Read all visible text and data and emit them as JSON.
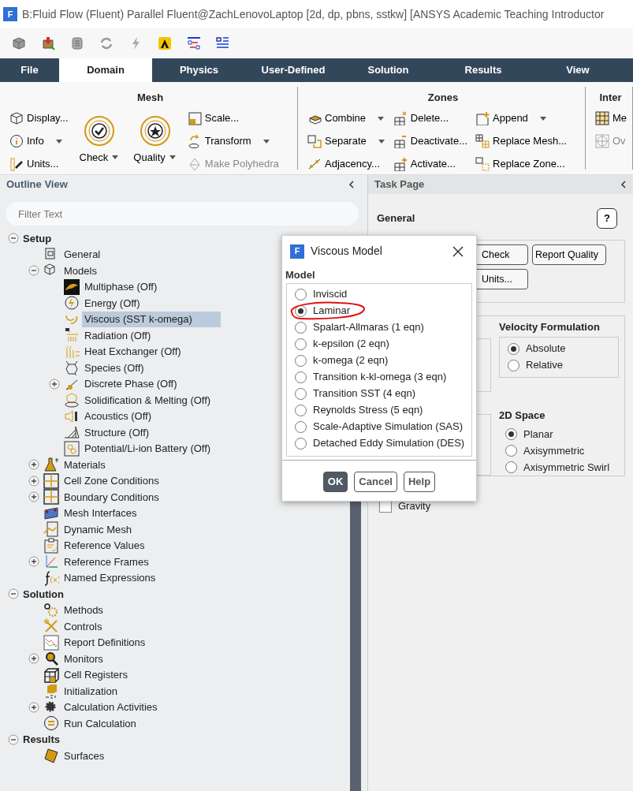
{
  "window": {
    "app_icon_letter": "F",
    "title": "B:Fluid Flow (Fluent) Parallel Fluent@ZachLenovoLaptop  [2d, dp, pbns, sstkw] [ANSYS Academic Teaching Introductor"
  },
  "ribbon_tabs": [
    {
      "label": "File",
      "selected": false
    },
    {
      "label": "Domain",
      "selected": true
    },
    {
      "label": "Physics",
      "selected": false
    },
    {
      "label": "User-Defined",
      "selected": false
    },
    {
      "label": "Solution",
      "selected": false
    },
    {
      "label": "Results",
      "selected": false
    },
    {
      "label": "View",
      "selected": false
    }
  ],
  "ribbon_groups": [
    {
      "title": "Mesh",
      "columns": [
        [
          {
            "kind": "small",
            "label": "Display...",
            "dropdown": false,
            "disabled": false
          },
          {
            "kind": "small",
            "label": "Info",
            "dropdown": true,
            "disabled": false
          },
          {
            "kind": "small",
            "label": "Units...",
            "dropdown": false,
            "disabled": false
          }
        ],
        [
          {
            "kind": "large",
            "label": "Check",
            "dropdown": true,
            "disabled": false
          }
        ],
        [
          {
            "kind": "large",
            "label": "Quality",
            "dropdown": true,
            "disabled": false
          }
        ],
        [
          {
            "kind": "small",
            "label": "Scale...",
            "dropdown": false,
            "disabled": false
          },
          {
            "kind": "small",
            "label": "Transform",
            "dropdown": true,
            "disabled": false
          },
          {
            "kind": "small",
            "label": "Make Polyhedra",
            "dropdown": false,
            "disabled": true
          }
        ]
      ]
    },
    {
      "title": "Zones",
      "columns": [
        [
          {
            "kind": "small",
            "label": "Combine",
            "dropdown": true,
            "disabled": false
          },
          {
            "kind": "small",
            "label": "Separate",
            "dropdown": true,
            "disabled": false
          },
          {
            "kind": "small",
            "label": "Adjacency...",
            "dropdown": false,
            "disabled": false
          }
        ],
        [
          {
            "kind": "small",
            "label": "Delete...",
            "dropdown": false,
            "disabled": false
          },
          {
            "kind": "small",
            "label": "Deactivate...",
            "dropdown": false,
            "disabled": false
          },
          {
            "kind": "small",
            "label": "Activate...",
            "dropdown": false,
            "disabled": false
          }
        ],
        [
          {
            "kind": "small",
            "label": "Append",
            "dropdown": true,
            "disabled": false
          },
          {
            "kind": "small",
            "label": "Replace Mesh...",
            "dropdown": false,
            "disabled": false
          },
          {
            "kind": "small",
            "label": "Replace Zone...",
            "dropdown": false,
            "disabled": false
          }
        ]
      ]
    },
    {
      "title": "Inter",
      "columns": [
        [
          {
            "kind": "small",
            "label": "Me",
            "dropdown": false,
            "disabled": false
          },
          {
            "kind": "small",
            "label": "Ov",
            "dropdown": false,
            "disabled": true
          }
        ]
      ]
    }
  ],
  "outline_view": {
    "title": "Outline View",
    "filter": {
      "placeholder": "Filter Text"
    },
    "tree": [
      {
        "kind": "section",
        "label": "Setup",
        "expanded": true,
        "selected": false,
        "children": [
          {
            "kind": "node",
            "label": "General",
            "selected": false
          },
          {
            "kind": "node",
            "label": "Models",
            "expanded": true,
            "selected": false,
            "children": [
              {
                "kind": "node",
                "label": "Multiphase (Off)",
                "selected": false
              },
              {
                "kind": "node",
                "label": "Energy (Off)",
                "selected": false
              },
              {
                "kind": "node",
                "label": "Viscous (SST k-omega)",
                "selected": true
              },
              {
                "kind": "node",
                "label": "Radiation (Off)",
                "selected": false
              },
              {
                "kind": "node",
                "label": "Heat Exchanger (Off)",
                "selected": false
              },
              {
                "kind": "node",
                "label": "Species (Off)",
                "selected": false
              },
              {
                "kind": "node",
                "label": "Discrete Phase (Off)",
                "expanded": false,
                "selected": false
              },
              {
                "kind": "node",
                "label": "Solidification & Melting (Off)",
                "selected": false
              },
              {
                "kind": "node",
                "label": "Acoustics (Off)",
                "selected": false
              },
              {
                "kind": "node",
                "label": "Structure (Off)",
                "selected": false
              },
              {
                "kind": "node",
                "label": "Potential/Li-ion Battery (Off)",
                "selected": false
              }
            ]
          },
          {
            "kind": "node",
            "label": "Materials",
            "expanded": false,
            "selected": false
          },
          {
            "kind": "node",
            "label": "Cell Zone Conditions",
            "expanded": false,
            "selected": false
          },
          {
            "kind": "node",
            "label": "Boundary Conditions",
            "expanded": false,
            "selected": false
          },
          {
            "kind": "node",
            "label": "Mesh Interfaces",
            "selected": false
          },
          {
            "kind": "node",
            "label": "Dynamic Mesh",
            "selected": false
          },
          {
            "kind": "node",
            "label": "Reference Values",
            "selected": false
          },
          {
            "kind": "node",
            "label": "Reference Frames",
            "expanded": false,
            "selected": false
          },
          {
            "kind": "node",
            "label": "Named Expressions",
            "selected": false
          }
        ]
      },
      {
        "kind": "section",
        "label": "Solution",
        "expanded": true,
        "selected": false,
        "children": [
          {
            "kind": "node",
            "label": "Methods",
            "selected": false
          },
          {
            "kind": "node",
            "label": "Controls",
            "selected": false
          },
          {
            "kind": "node",
            "label": "Report Definitions",
            "selected": false
          },
          {
            "kind": "node",
            "label": "Monitors",
            "expanded": false,
            "selected": false
          },
          {
            "kind": "node",
            "label": "Cell Registers",
            "selected": false
          },
          {
            "kind": "node",
            "label": "Initialization",
            "selected": false
          },
          {
            "kind": "node",
            "label": "Calculation Activities",
            "expanded": false,
            "selected": false
          },
          {
            "kind": "node",
            "label": "Run Calculation",
            "selected": false
          }
        ]
      },
      {
        "kind": "section",
        "label": "Results",
        "expanded": true,
        "selected": false,
        "children": [
          {
            "kind": "node",
            "label": "Surfaces",
            "selected": false
          }
        ]
      }
    ]
  },
  "task_page": {
    "header": "Task Page",
    "title": "General",
    "help_button": "?",
    "buttons": [
      {
        "label": "Check"
      },
      {
        "label": "Report Quality"
      },
      {
        "label": "Units..."
      }
    ],
    "velocity_formulation": {
      "title": "Velocity Formulation",
      "options": [
        {
          "label": "Absolute",
          "selected": true
        },
        {
          "label": "Relative",
          "selected": false
        }
      ]
    },
    "space_2d": {
      "title": "2D Space",
      "options": [
        {
          "label": "Planar",
          "selected": true
        },
        {
          "label": "Axisymmetric",
          "selected": false
        },
        {
          "label": "Axisymmetric Swirl",
          "selected": false
        }
      ]
    },
    "gravity": {
      "label": "Gravity",
      "checked": false
    }
  },
  "dialog": {
    "app_icon_letter": "F",
    "title": "Viscous Model",
    "group_title": "Model",
    "options": [
      {
        "label": "Inviscid",
        "selected": false,
        "circled": false
      },
      {
        "label": "Laminar",
        "selected": true,
        "circled": true
      },
      {
        "label": "Spalart-Allmaras (1 eqn)",
        "selected": false,
        "circled": false
      },
      {
        "label": "k-epsilon (2 eqn)",
        "selected": false,
        "circled": false
      },
      {
        "label": "k-omega (2 eqn)",
        "selected": false,
        "circled": false
      },
      {
        "label": "Transition k-kl-omega (3 eqn)",
        "selected": false,
        "circled": false
      },
      {
        "label": "Transition SST (4 eqn)",
        "selected": false,
        "circled": false
      },
      {
        "label": "Reynolds Stress (5 eqn)",
        "selected": false,
        "circled": false
      },
      {
        "label": "Scale-Adaptive Simulation (SAS)",
        "selected": false,
        "circled": false
      },
      {
        "label": "Detached Eddy Simulation (DES)",
        "selected": false,
        "circled": false
      }
    ],
    "buttons": [
      {
        "label": "OK",
        "default": true
      },
      {
        "label": "Cancel",
        "default": false
      },
      {
        "label": "Help",
        "default": false
      }
    ]
  }
}
